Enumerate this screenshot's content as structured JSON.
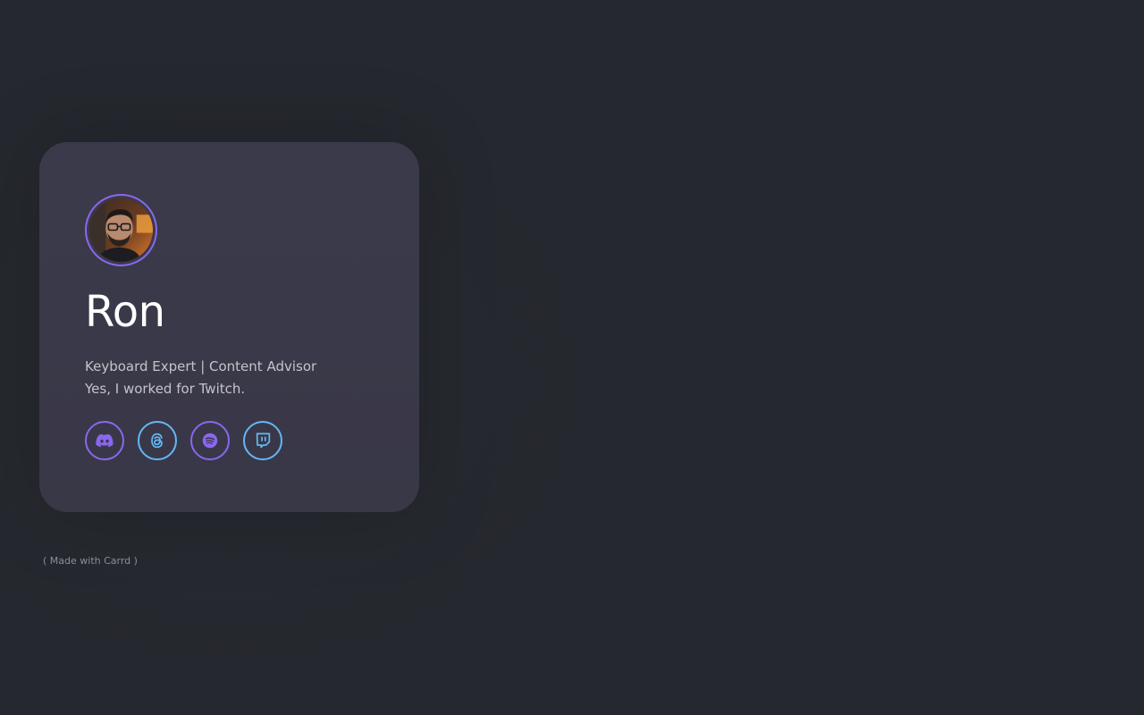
{
  "profile": {
    "name": "Ron",
    "bio_line1": "Keyboard Expert | Content Advisor",
    "bio_line2": "Yes, I worked for Twitch."
  },
  "socials": [
    {
      "label": "Discord",
      "icon": "discord-icon",
      "color": "#8a67f0"
    },
    {
      "label": "Threads",
      "icon": "threads-icon",
      "color": "#63b8f5"
    },
    {
      "label": "Spotify",
      "icon": "spotify-icon",
      "color": "#8a67f0"
    },
    {
      "label": "Twitch",
      "icon": "twitch-icon",
      "color": "#63b8f5"
    }
  ],
  "footer": {
    "credit": "( Made with Carrd )"
  },
  "colors": {
    "background": "#25282e",
    "card": "#3b3a4b",
    "accent_purple": "#8a67f0",
    "accent_blue": "#63b8f5"
  }
}
